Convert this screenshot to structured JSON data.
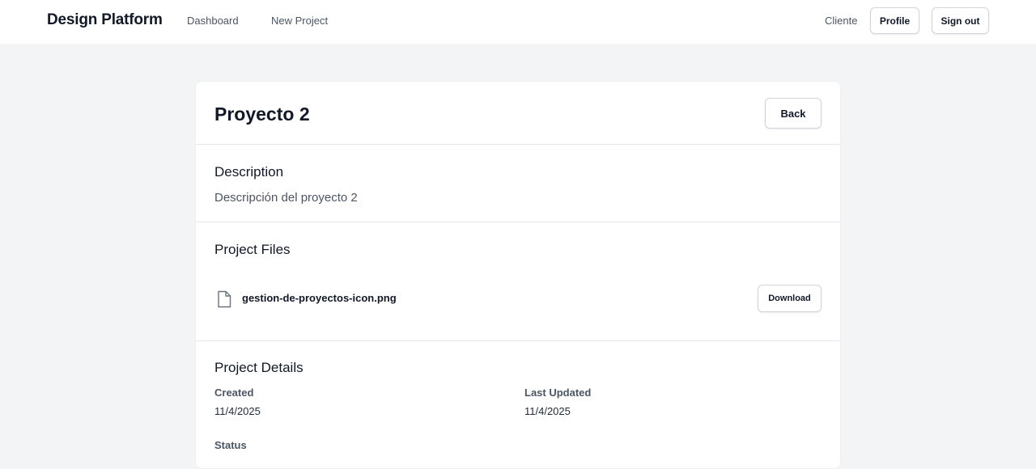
{
  "header": {
    "brand": "Design Platform",
    "nav": {
      "dashboard": "Dashboard",
      "new_project": "New Project"
    },
    "user_role": "Cliente",
    "profile_label": "Profile",
    "sign_out_label": "Sign out"
  },
  "project": {
    "title": "Proyecto 2",
    "back_label": "Back",
    "description": {
      "heading": "Description",
      "text": "Descripción del proyecto 2"
    },
    "files": {
      "heading": "Project Files",
      "items": [
        {
          "name": "gestion-de-proyectos-icon.png",
          "icon": "file-icon",
          "action_label": "Download"
        }
      ]
    },
    "details": {
      "heading": "Project Details",
      "created_label": "Created",
      "created_value": "11/4/2025",
      "updated_label": "Last Updated",
      "updated_value": "11/4/2025",
      "status_label": "Status"
    }
  },
  "colors": {
    "page_background": "#f3f4f6",
    "card_background": "#ffffff",
    "text_primary": "#111827",
    "text_secondary": "#4b5563",
    "border": "#e5e7eb"
  }
}
